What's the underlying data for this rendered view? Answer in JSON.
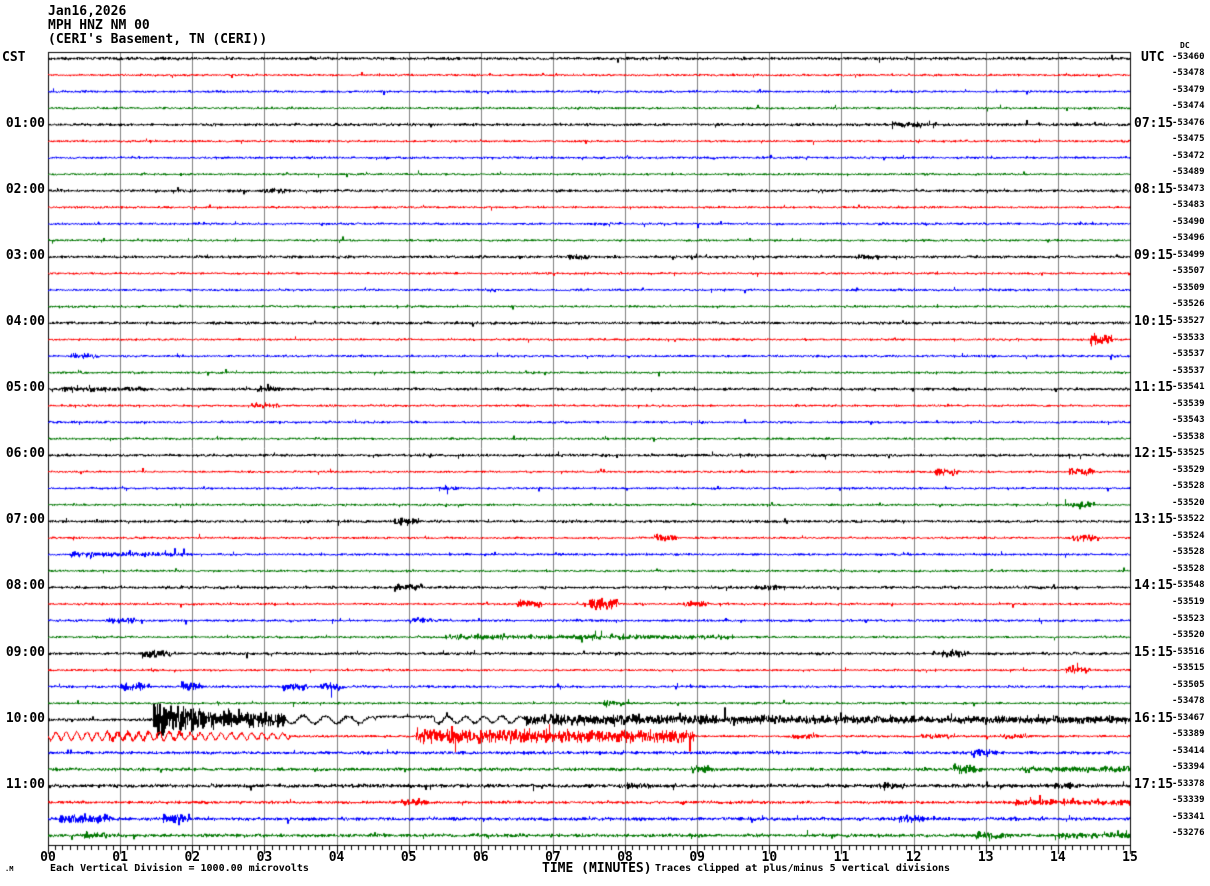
{
  "header": {
    "date": "Jan16,2026",
    "station": "MPH HNZ NM 00",
    "location": "(CERI's Basement, TN (CERI))"
  },
  "axis": {
    "left_header": "CST",
    "right_header": "UTC",
    "dc_header": "DC",
    "x_axis_label": "TIME (MINUTES)",
    "x_ticks": [
      "00",
      "01",
      "02",
      "03",
      "04",
      "05",
      "06",
      "07",
      "08",
      "09",
      "10",
      "11",
      "12",
      "13",
      "14",
      "15"
    ],
    "left_hour_labels": [
      "01:00",
      "02:00",
      "03:00",
      "04:00",
      "05:00",
      "06:00",
      "07:00",
      "08:00",
      "09:00",
      "10:00",
      "11:00"
    ],
    "right_hour_labels": [
      "07:15",
      "08:15",
      "09:15",
      "10:15",
      "11:15",
      "12:15",
      "13:15",
      "14:15",
      "15:15",
      "16:15",
      "17:15"
    ]
  },
  "footer": {
    "scale_note": "Each Vertical Division = 1000.00 microvolts",
    "clip_note": "Traces clipped at plus/minus 5 vertical divisions",
    "watermark": ".M"
  },
  "chart_data": {
    "type": "line",
    "subtype": "helicorder-seismogram",
    "title": "MPH HNZ NM 00 (CERI's Basement, TN (CERI)) Jan16,2026",
    "xlabel": "TIME (MINUTES)",
    "x_range_minutes": [
      0,
      15
    ],
    "rows_per_hour": 4,
    "minutes_per_row": 15,
    "timezone_left": "CST",
    "timezone_right": "UTC",
    "microvolts_per_division": 1000.0,
    "clip_divisions": 5,
    "grid_color": "#808080",
    "trace_order_colors": [
      "#000000",
      "#ff0000",
      "#0000ff",
      "#007700"
    ],
    "rows": [
      {
        "start_cst": "00:00",
        "color": "#000000",
        "dc": -53460,
        "base": 1.3,
        "events": []
      },
      {
        "start_cst": "00:15",
        "color": "#ff0000",
        "dc": -53478,
        "base": 0.95,
        "events": []
      },
      {
        "start_cst": "00:30",
        "color": "#0000ff",
        "dc": -53479,
        "base": 1.0,
        "events": []
      },
      {
        "start_cst": "00:45",
        "color": "#007700",
        "dc": -53474,
        "base": 0.95,
        "events": []
      },
      {
        "start_cst": "01:00",
        "color": "#000000",
        "dc": -53476,
        "base": 1.2,
        "events": [
          [
            11.7,
            12.1,
            2.5,
            2,
            "band",
            0
          ]
        ]
      },
      {
        "start_cst": "01:15",
        "color": "#ff0000",
        "dc": -53475,
        "base": 0.95,
        "events": []
      },
      {
        "start_cst": "01:30",
        "color": "#0000ff",
        "dc": -53472,
        "base": 1.0,
        "events": []
      },
      {
        "start_cst": "01:45",
        "color": "#007700",
        "dc": -53489,
        "base": 0.95,
        "events": []
      },
      {
        "start_cst": "02:00",
        "color": "#000000",
        "dc": -53473,
        "base": 1.2,
        "events": [
          [
            3.0,
            3.35,
            2,
            2,
            "band",
            0
          ]
        ]
      },
      {
        "start_cst": "02:15",
        "color": "#ff0000",
        "dc": -53483,
        "base": 0.95,
        "events": []
      },
      {
        "start_cst": "02:30",
        "color": "#0000ff",
        "dc": -53490,
        "base": 1.0,
        "events": []
      },
      {
        "start_cst": "02:45",
        "color": "#007700",
        "dc": -53496,
        "base": 0.95,
        "events": []
      },
      {
        "start_cst": "03:00",
        "color": "#000000",
        "dc": -53499,
        "base": 1.2,
        "events": [
          [
            7.2,
            7.5,
            2,
            2,
            "band",
            0
          ],
          [
            11.2,
            11.5,
            2,
            2,
            "band",
            0
          ]
        ]
      },
      {
        "start_cst": "03:15",
        "color": "#ff0000",
        "dc": -53507,
        "base": 0.95,
        "events": []
      },
      {
        "start_cst": "03:30",
        "color": "#0000ff",
        "dc": -53509,
        "base": 1.0,
        "events": []
      },
      {
        "start_cst": "03:45",
        "color": "#007700",
        "dc": -53526,
        "base": 0.95,
        "events": []
      },
      {
        "start_cst": "04:00",
        "color": "#000000",
        "dc": -53527,
        "base": 1.2,
        "events": []
      },
      {
        "start_cst": "04:15",
        "color": "#ff0000",
        "dc": -53533,
        "base": 0.95,
        "events": [
          [
            14.45,
            14.75,
            6,
            3,
            "band",
            0
          ]
        ]
      },
      {
        "start_cst": "04:30",
        "color": "#0000ff",
        "dc": -53537,
        "base": 1.0,
        "events": [
          [
            0.3,
            0.7,
            2.5,
            2,
            "band",
            0
          ]
        ]
      },
      {
        "start_cst": "04:45",
        "color": "#007700",
        "dc": -53537,
        "base": 0.95,
        "events": []
      },
      {
        "start_cst": "05:00",
        "color": "#000000",
        "dc": -53541,
        "base": 1.2,
        "events": [
          [
            0.2,
            1.4,
            2.2,
            1.5,
            "band",
            0
          ],
          [
            2.9,
            3.25,
            2.5,
            2,
            "band",
            0
          ]
        ]
      },
      {
        "start_cst": "05:15",
        "color": "#ff0000",
        "dc": -53539,
        "base": 0.95,
        "events": [
          [
            2.8,
            3.2,
            2,
            2,
            "band",
            0
          ]
        ]
      },
      {
        "start_cst": "05:30",
        "color": "#0000ff",
        "dc": -53543,
        "base": 1.0,
        "events": []
      },
      {
        "start_cst": "05:45",
        "color": "#007700",
        "dc": -53538,
        "base": 0.95,
        "events": []
      },
      {
        "start_cst": "06:00",
        "color": "#000000",
        "dc": -53525,
        "base": 1.2,
        "events": []
      },
      {
        "start_cst": "06:15",
        "color": "#ff0000",
        "dc": -53529,
        "base": 0.95,
        "events": [
          [
            12.3,
            12.65,
            3.5,
            2.5,
            "band",
            0
          ],
          [
            14.15,
            14.5,
            3.5,
            3,
            "band",
            0
          ]
        ]
      },
      {
        "start_cst": "06:30",
        "color": "#0000ff",
        "dc": -53528,
        "base": 1.0,
        "events": [
          [
            5.4,
            5.7,
            2,
            2,
            "band",
            0
          ]
        ]
      },
      {
        "start_cst": "06:45",
        "color": "#007700",
        "dc": -53520,
        "base": 0.95,
        "events": [
          [
            14.1,
            14.5,
            4,
            3,
            "band",
            0
          ]
        ]
      },
      {
        "start_cst": "07:00",
        "color": "#000000",
        "dc": -53522,
        "base": 1.2,
        "events": [
          [
            4.8,
            5.15,
            3,
            2.5,
            "band",
            0
          ]
        ]
      },
      {
        "start_cst": "07:15",
        "color": "#ff0000",
        "dc": -53524,
        "base": 0.95,
        "events": [
          [
            8.4,
            8.7,
            3,
            2.5,
            "band",
            0
          ],
          [
            14.2,
            14.55,
            3,
            2.5,
            "band",
            0
          ]
        ]
      },
      {
        "start_cst": "07:30",
        "color": "#0000ff",
        "dc": -53528,
        "base": 1.0,
        "events": [
          [
            0.3,
            2.0,
            2.2,
            1.5,
            "band",
            0
          ]
        ]
      },
      {
        "start_cst": "07:45",
        "color": "#007700",
        "dc": -53528,
        "base": 0.95,
        "events": []
      },
      {
        "start_cst": "08:00",
        "color": "#000000",
        "dc": -53548,
        "base": 1.2,
        "events": [
          [
            4.8,
            5.2,
            2.8,
            2.2,
            "band",
            0
          ],
          [
            9.8,
            10.15,
            2.2,
            2,
            "band",
            0
          ]
        ]
      },
      {
        "start_cst": "08:15",
        "color": "#ff0000",
        "dc": -53519,
        "base": 0.95,
        "events": [
          [
            6.5,
            6.85,
            3,
            2.5,
            "band",
            0
          ],
          [
            7.5,
            7.9,
            7,
            4,
            "band",
            0
          ],
          [
            8.8,
            9.15,
            3,
            2.5,
            "band",
            0
          ]
        ]
      },
      {
        "start_cst": "08:30",
        "color": "#0000ff",
        "dc": -53523,
        "base": 1.05,
        "events": [
          [
            0.8,
            1.2,
            2.5,
            2,
            "band",
            0
          ],
          [
            5.0,
            5.35,
            2.5,
            2,
            "band",
            0
          ]
        ]
      },
      {
        "start_cst": "08:45",
        "color": "#007700",
        "dc": -53520,
        "base": 0.95,
        "events": [
          [
            5.5,
            9.5,
            1.8,
            1.8,
            "band",
            0
          ]
        ]
      },
      {
        "start_cst": "09:00",
        "color": "#000000",
        "dc": -53516,
        "base": 1.2,
        "events": [
          [
            1.3,
            1.7,
            4,
            2.5,
            "band",
            0
          ],
          [
            12.4,
            12.75,
            3,
            2.5,
            "band",
            0
          ]
        ]
      },
      {
        "start_cst": "09:15",
        "color": "#ff0000",
        "dc": -53515,
        "base": 0.95,
        "events": [
          [
            14.1,
            14.45,
            3,
            2.5,
            "band",
            0
          ]
        ]
      },
      {
        "start_cst": "09:30",
        "color": "#0000ff",
        "dc": -53505,
        "base": 1.05,
        "events": [
          [
            1.0,
            1.4,
            3.5,
            2.5,
            "band",
            0
          ],
          [
            1.85,
            2.15,
            5,
            3,
            "band",
            0
          ],
          [
            3.25,
            3.6,
            4,
            3,
            "band",
            0
          ],
          [
            3.75,
            4.1,
            4,
            3,
            "band",
            0
          ]
        ]
      },
      {
        "start_cst": "09:45",
        "color": "#007700",
        "dc": -53478,
        "base": 0.95,
        "events": [
          [
            7.7,
            8.05,
            2.5,
            2,
            "band",
            0
          ]
        ]
      },
      {
        "start_cst": "10:00",
        "color": "#000000",
        "dc": -53467,
        "base": 1.25,
        "events": [
          [
            1.45,
            2.05,
            17,
            12,
            "band",
            0
          ],
          [
            2.05,
            3.3,
            9,
            5,
            "band",
            0
          ],
          [
            3.3,
            4.55,
            4.5,
            3,
            "sine",
            3.2
          ],
          [
            4.55,
            5.35,
            -3,
            -3,
            "dc",
            0
          ],
          [
            5.35,
            6.6,
            3.5,
            3,
            "sine",
            4
          ],
          [
            6.6,
            9.0,
            4.5,
            4,
            "band",
            0
          ],
          [
            9.0,
            13.0,
            4,
            3.2,
            "band",
            0
          ],
          [
            13.0,
            15,
            3.2,
            3,
            "band",
            0
          ]
        ]
      },
      {
        "start_cst": "10:15",
        "color": "#ff0000",
        "dc": -53389,
        "base": 1.0,
        "events": [
          [
            0,
            3.35,
            4,
            3,
            "sine",
            7
          ],
          [
            0.8,
            2.1,
            2.5,
            1.5,
            "band",
            0
          ],
          [
            5.1,
            8.95,
            6,
            5,
            "band",
            0
          ],
          [
            10.3,
            10.7,
            2,
            2,
            "band",
            0
          ],
          [
            12.1,
            12.5,
            2,
            2,
            "band",
            0
          ],
          [
            13.2,
            13.6,
            2,
            2,
            "band",
            0
          ]
        ]
      },
      {
        "start_cst": "10:30",
        "color": "#0000ff",
        "dc": -53414,
        "base": 1.3,
        "events": [
          [
            12.8,
            13.15,
            3,
            2.5,
            "band",
            0
          ]
        ]
      },
      {
        "start_cst": "10:45",
        "color": "#007700",
        "dc": -53394,
        "base": 1.35,
        "events": [
          [
            8.9,
            9.25,
            3,
            2.5,
            "band",
            0
          ],
          [
            12.55,
            12.95,
            4,
            3,
            "band",
            0
          ],
          [
            13.5,
            15,
            2.2,
            2,
            "band",
            0
          ]
        ]
      },
      {
        "start_cst": "11:00",
        "color": "#000000",
        "dc": -53378,
        "base": 1.55,
        "events": [
          [
            8.0,
            8.4,
            2.5,
            2,
            "band",
            0
          ],
          [
            11.5,
            11.9,
            2.5,
            2,
            "band",
            0
          ],
          [
            13.9,
            14.3,
            2.8,
            2.2,
            "band",
            0
          ]
        ]
      },
      {
        "start_cst": "11:15",
        "color": "#ff0000",
        "dc": -53339,
        "base": 1.25,
        "events": [
          [
            4.9,
            5.3,
            2.5,
            2,
            "band",
            0
          ],
          [
            13.4,
            15,
            2.5,
            2.2,
            "band",
            0
          ]
        ]
      },
      {
        "start_cst": "11:30",
        "color": "#0000ff",
        "dc": -53341,
        "base": 1.45,
        "events": [
          [
            0.15,
            0.9,
            4,
            2.5,
            "band",
            0
          ],
          [
            1.6,
            1.95,
            5,
            3,
            "band",
            0
          ],
          [
            11.8,
            12.15,
            3,
            2.5,
            "band",
            0
          ]
        ]
      },
      {
        "start_cst": "11:45",
        "color": "#007700",
        "dc": -53276,
        "base": 1.45,
        "events": [
          [
            0.5,
            0.85,
            3,
            2.5,
            "band",
            0
          ],
          [
            12.85,
            13.35,
            3,
            2.5,
            "band",
            0
          ],
          [
            14.0,
            15,
            2.2,
            2,
            "band",
            0
          ]
        ]
      }
    ]
  }
}
